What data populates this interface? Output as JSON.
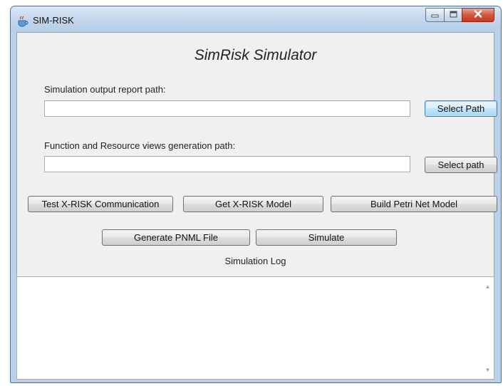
{
  "window": {
    "title": "SIM-RISK",
    "colors": {
      "frame": "#b9d1ea",
      "client_bg": "#f0f0f0",
      "close_red": "#c23a22"
    }
  },
  "main": {
    "heading": "SimRisk Simulator",
    "report_path_label": "Simulation output report path:",
    "report_path_value": "",
    "views_path_label": "Function and Resource views generation path:",
    "views_path_value": "",
    "select_path_button_1": "Select Path",
    "select_path_button_2": "Select path",
    "test_comm_button": "Test X-RISK Communication",
    "get_model_button": "Get X-RISK Model",
    "build_petri_button": "Build Petri Net Model",
    "generate_pnml_button": "Generate PNML File",
    "simulate_button": "Simulate",
    "log_label": "Simulation Log",
    "log_text": ""
  },
  "icons": {
    "app": "java-cup-icon",
    "minimize": "minimize-icon",
    "maximize": "maximize-icon",
    "close": "close-icon"
  }
}
